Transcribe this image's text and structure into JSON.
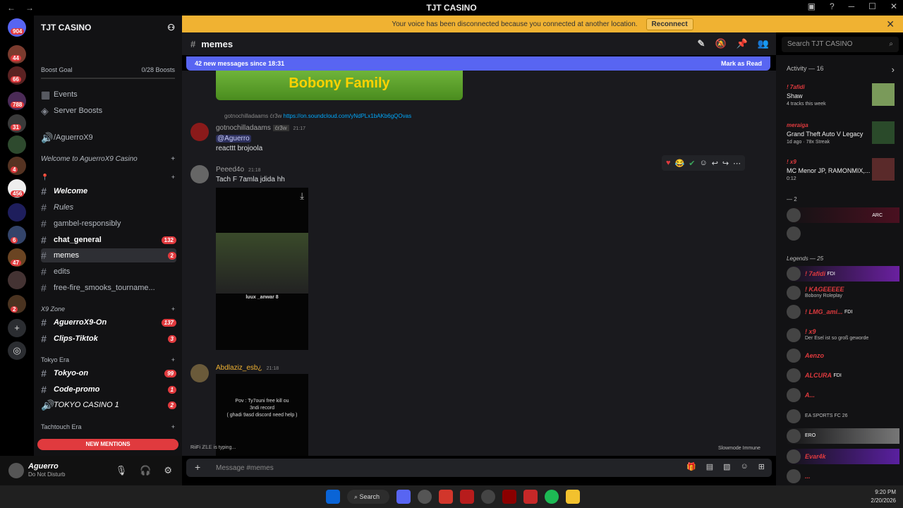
{
  "app": {
    "title": "TJT CASINO",
    "nav_back": "←",
    "nav_forward": "→",
    "window_controls": [
      "─",
      "☐",
      "✕"
    ]
  },
  "guilds": {
    "badges": [
      "904",
      "44",
      "66",
      "788",
      "31",
      "4",
      "456",
      "6",
      "47",
      "2"
    ]
  },
  "sidebar": {
    "server_name": "TJT CASINO",
    "boost_goal": "Boost Goal",
    "boost_count": "0/28 Boosts",
    "events": "Events",
    "server_boosts": "Server Boosts",
    "voice_agx": "/AguerroX9",
    "cat_welcome": "Welcome to AguerroX9 Casino",
    "cat_pin": "📍",
    "channels": [
      {
        "label": "Welcome",
        "badge": ""
      },
      {
        "label": "Rules",
        "badge": ""
      },
      {
        "label": "gambel-responsibly",
        "badge": ""
      },
      {
        "label": "chat_general",
        "badge": "132"
      },
      {
        "label": "memes",
        "badge": "2"
      },
      {
        "label": "edits",
        "badge": ""
      },
      {
        "label": "free-fire_smooks_tourname...",
        "badge": ""
      }
    ],
    "cat_x9": "X9 Zone",
    "x9_channels": [
      {
        "label": "AguerroX9-On",
        "badge": "137"
      },
      {
        "label": "Clips-Tiktok",
        "badge": "3"
      }
    ],
    "cat_tokyo": "Tokyo Era",
    "tokyo_channels": [
      {
        "label": "Tokyo-on",
        "badge": "99"
      },
      {
        "label": "Code-promo",
        "badge": "1"
      },
      {
        "label": "TOKYO CASINO",
        "badge": "2"
      }
    ],
    "tokyo_voice_count": "1",
    "cat_tachtouch": "Tachtouch Era",
    "new_mentions": "NEW MENTIONS"
  },
  "user": {
    "name": "Aguerro",
    "status": "Do Not Disturb"
  },
  "voice_banner": {
    "text": "Your voice has been disconnected because you connected at another location.",
    "button": "Reconnect"
  },
  "channel_header": {
    "name": "memes",
    "search_placeholder": "Search TJT CASINO"
  },
  "new_messages": {
    "text": "42 new messages since 18:31",
    "mark_read": "Mark as Read"
  },
  "messages": [
    {
      "author": "gotnochilladaams",
      "tag": "ćr3w",
      "time": "21:17",
      "reply_author": "gotnochilladaams",
      "reply_tag": "ćr3w",
      "reply_text": "https://on.soundcloud.com/yNdPLx1bAKb6gQOvas",
      "mention": "@Aguerro",
      "text": "reacttt brojoola"
    },
    {
      "author": "Peeed4o",
      "time": "21:18",
      "text": "Tach F 7amla jdida hh",
      "video_caption": "luux _anwar 8"
    },
    {
      "author": "Abdlaziz_esb¿",
      "time": "21:18",
      "video_text_1": "Pov : Ty7ouni free kill ou",
      "video_text_2": "3ndi record",
      "video_text_3": "( ghadi 9asd discord need help )"
    }
  ],
  "image_banner": "Bobony Family",
  "typing": "RiiFi ℤ𝕃𝔼 is typing...",
  "slowmode": "Slowmode Immune",
  "composer_placeholder": "Message #memes",
  "activity": {
    "header": "Activity — 16",
    "items": [
      {
        "name": "! 7afidi",
        "title": "Shaw",
        "sub": "4 tracks this week"
      },
      {
        "name": "meraiga",
        "title": "Grand Theft Auto V Legacy",
        "sub": "1d ago · 78x Streak"
      },
      {
        "name": "! x9",
        "title": "MC Menor JP, RAMONMIX,...",
        "sub": "0:12"
      }
    ]
  },
  "members": {
    "group1": "— 2",
    "arc": "ARC",
    "legends": "Legends — 25",
    "list": [
      {
        "name": "! 7afidi",
        "tag": "FDI",
        "sub": ""
      },
      {
        "name": "! KAGEEEEE",
        "tag": "",
        "sub": "Bobony Roleplay"
      },
      {
        "name": "! LMG_ami...",
        "tag": "FDI",
        "sub": ""
      },
      {
        "name": "! x9",
        "tag": "",
        "sub": "Der Esel ist so groß geworde"
      },
      {
        "name": "Aenzo",
        "tag": "",
        "sub": ""
      },
      {
        "name": "ALCURA",
        "tag": "FDI",
        "sub": ""
      },
      {
        "name": "A...",
        "tag": "",
        "sub": ""
      },
      {
        "name": "",
        "tag": "",
        "sub": "EA SPORTS FC 26"
      },
      {
        "name": "",
        "tag": "",
        "sub": "ERO"
      },
      {
        "name": "Evar4k",
        "tag": "",
        "sub": ""
      },
      {
        "name": "...",
        "tag": "",
        "sub": ""
      }
    ]
  },
  "taskbar": {
    "search": "Search",
    "time": "9:20 PM",
    "date": "2/20/2026"
  },
  "colors": {
    "accent": "#5865f2",
    "warning": "#f0b232",
    "danger": "#e03a3e"
  }
}
